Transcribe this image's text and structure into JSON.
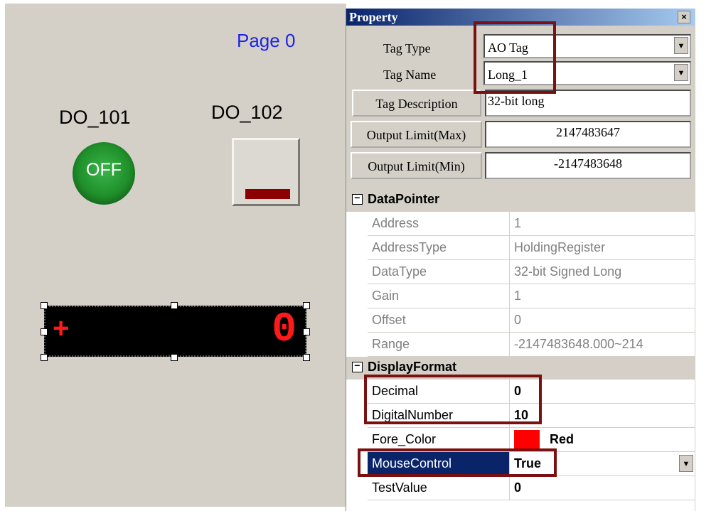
{
  "canvas": {
    "page_title": "Page 0",
    "do101_label": "DO_101",
    "do102_label": "DO_102",
    "off_button_text": "OFF",
    "display_sign": "+",
    "display_digit": "0"
  },
  "property": {
    "title": "Property",
    "close_glyph": "×",
    "tag_type": {
      "label": "Tag Type",
      "value": "AO Tag"
    },
    "tag_name": {
      "label": "Tag Name",
      "value": "Long_1"
    },
    "tag_description": {
      "label": "Tag Description",
      "value": "32-bit long"
    },
    "output_max": {
      "label": "Output Limit(Max)",
      "value": "2147483647"
    },
    "output_min": {
      "label": "Output Limit(Min)",
      "value": "-2147483648"
    },
    "data_pointer": {
      "name": "DataPointer",
      "rows": [
        {
          "name": "Address",
          "value": "1"
        },
        {
          "name": "AddressType",
          "value": "HoldingRegister"
        },
        {
          "name": "DataType",
          "value": "32-bit Signed Long"
        },
        {
          "name": "Gain",
          "value": "1"
        },
        {
          "name": "Offset",
          "value": "0"
        },
        {
          "name": "Range",
          "value": "-2147483648.000~214"
        }
      ]
    },
    "display_format": {
      "name": "DisplayFormat",
      "decimal": {
        "name": "Decimal",
        "value": "0"
      },
      "digital_number": {
        "name": "DigitalNumber",
        "value": "10"
      },
      "fore_color": {
        "name": "Fore_Color",
        "value": "Red",
        "swatch": "#ff0000"
      },
      "mouse_control": {
        "name": "MouseControl",
        "value": "True"
      },
      "test_value": {
        "name": "TestValue",
        "value": "0"
      }
    },
    "collapse_glyph": "−"
  },
  "colors": {
    "accent_title": "#0a246a",
    "highlight_box": "#7a1010",
    "led_red": "#ff1a1a"
  }
}
